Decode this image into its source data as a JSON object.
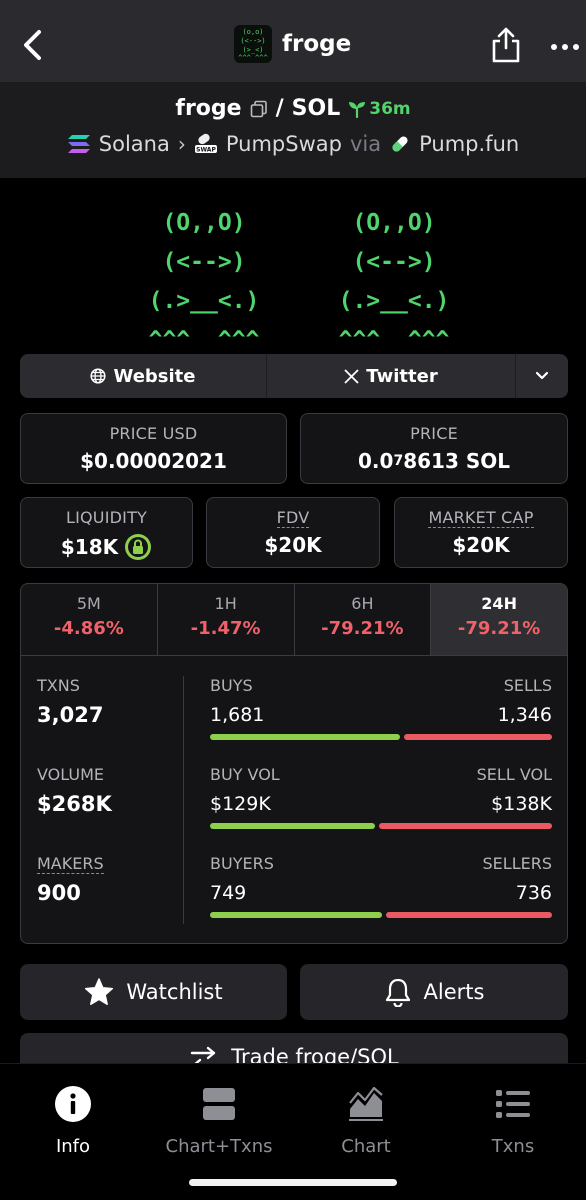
{
  "topnav": {
    "title": "froge",
    "logo_text": [
      "(o,o)",
      "(<-->)",
      "(>_<)",
      "^^^ ^^^"
    ]
  },
  "pair": {
    "base": "froge",
    "separator": "/",
    "quote": "SOL",
    "age": "36m",
    "chain": "Solana",
    "dex": "PumpSwap",
    "via": "via",
    "launchpad": "Pump.fun"
  },
  "banner": {
    "art": "(O,,O)\n(<-->)\n(.>__<.)\n^^^  ^^^"
  },
  "links": {
    "website": "Website",
    "twitter": "Twitter"
  },
  "price": {
    "usd_label": "PRICE USD",
    "usd_value": "$0.00002021",
    "native_label": "PRICE",
    "native_prefix": "0.0",
    "native_subscript": "7",
    "native_rest": "8613 SOL"
  },
  "metrics": {
    "liquidity_label": "LIQUIDITY",
    "liquidity_value": "$18K",
    "fdv_label": "FDV",
    "fdv_value": "$20K",
    "mcap_label": "MARKET CAP",
    "mcap_value": "$20K"
  },
  "tabs": [
    {
      "label": "5M",
      "value": "-4.86%"
    },
    {
      "label": "1H",
      "value": "-1.47%"
    },
    {
      "label": "6H",
      "value": "-79.21%"
    },
    {
      "label": "24H",
      "value": "-79.21%",
      "active": true
    }
  ],
  "stats": {
    "txns_label": "TXNS",
    "txns_value": "3,027",
    "volume_label": "VOLUME",
    "volume_value": "$268K",
    "makers_label": "MAKERS",
    "makers_value": "900",
    "buys_label": "BUYS",
    "buys_value": "1,681",
    "sells_label": "SELLS",
    "sells_value": "1,346",
    "buys_ratio": 0.555,
    "buyvol_label": "BUY VOL",
    "buyvol_value": "$129K",
    "sellvol_label": "SELL VOL",
    "sellvol_value": "$138K",
    "buyvol_ratio": 0.483,
    "buyers_label": "BUYERS",
    "buyers_value": "749",
    "sellers_label": "SELLERS",
    "sellers_value": "736",
    "buyers_ratio": 0.504
  },
  "actions": {
    "watchlist": "Watchlist",
    "alerts": "Alerts",
    "trade": "Trade froge/SOL"
  },
  "bottomnav": [
    {
      "label": "Info",
      "active": true
    },
    {
      "label": "Chart+Txns"
    },
    {
      "label": "Chart"
    },
    {
      "label": "Txns"
    }
  ],
  "colors": {
    "positive": "#8fcf4e",
    "negative": "#ea5a63",
    "accent_green": "#54d36b"
  }
}
